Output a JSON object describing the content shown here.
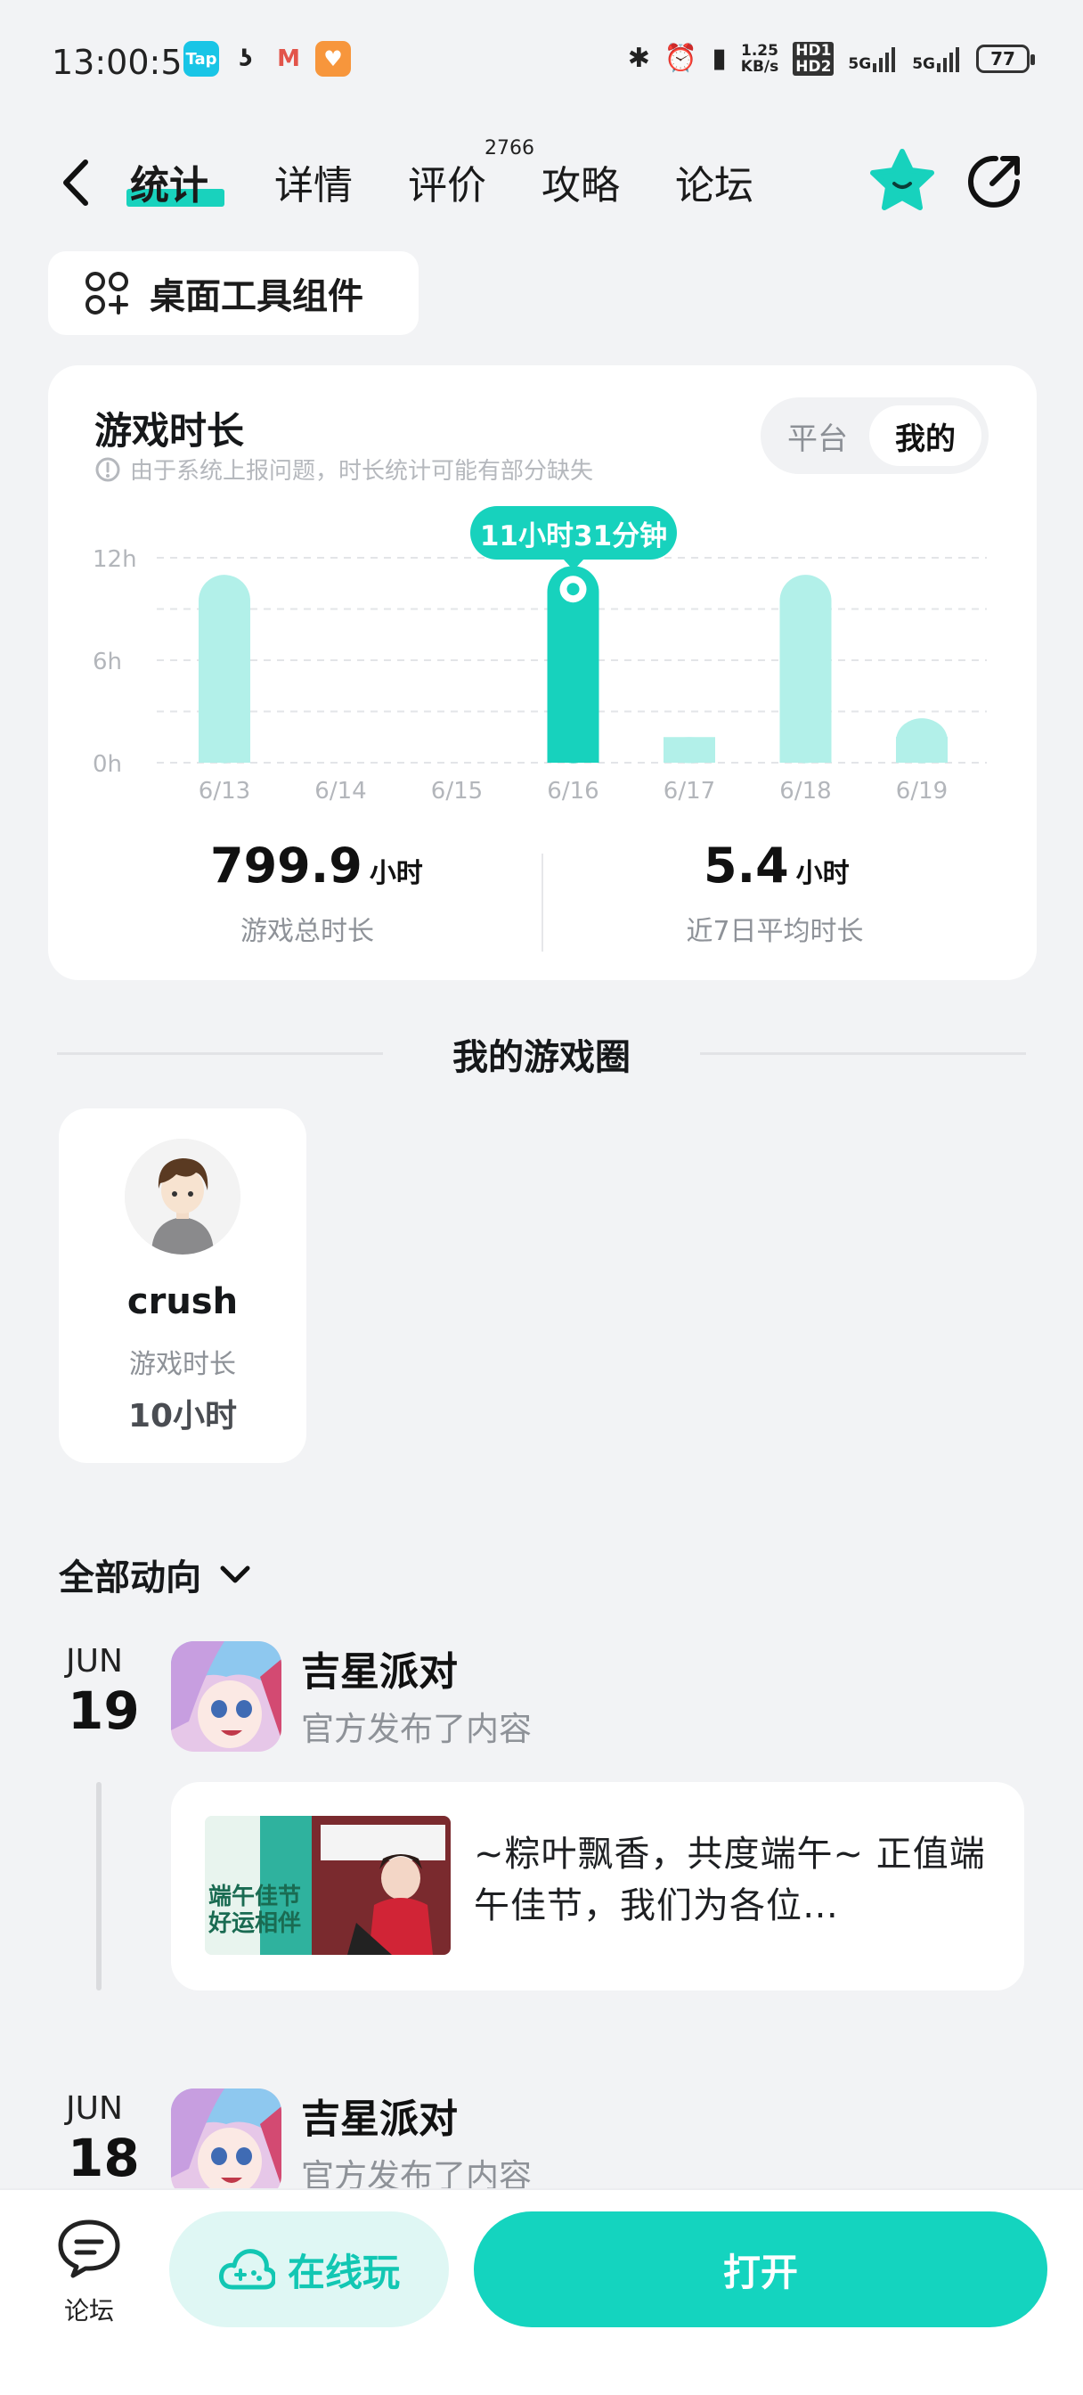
{
  "status_bar": {
    "time": "13:00:57",
    "apps": [
      "Tap",
      "ʖ",
      "M",
      "♥"
    ],
    "net_speed_top": "1.25",
    "net_speed_bottom": "KB/s",
    "hd1": "HD1",
    "hd2": "HD2",
    "sig1": "5G",
    "sig2": "5G",
    "battery": "77"
  },
  "nav": {
    "tabs": [
      {
        "label": "统计",
        "active": true
      },
      {
        "label": "详情"
      },
      {
        "label": "评价"
      },
      {
        "label": "攻略"
      },
      {
        "label": "论坛"
      }
    ],
    "review_count": "2766"
  },
  "widget_button": {
    "label": "桌面工具组件"
  },
  "game_time": {
    "title": "游戏时长",
    "note": "由于系统上报问题，时长统计可能有部分缺失",
    "toggle": {
      "platform": "平台",
      "mine": "我的",
      "selected": "我的"
    },
    "tooltip": "11小时31分钟",
    "total_value": "799.9",
    "total_unit": "小时",
    "total_label": "游戏总时长",
    "avg_value": "5.4",
    "avg_unit": "小时",
    "avg_label": "近7日平均时长"
  },
  "chart_data": {
    "type": "bar",
    "categories": [
      "6/13",
      "6/14",
      "6/15",
      "6/16",
      "6/17",
      "6/18",
      "6/19"
    ],
    "values": [
      11.0,
      0,
      0,
      11.52,
      1.5,
      11.0,
      2.6
    ],
    "y_ticks": [
      "12h",
      "6h",
      "0h"
    ],
    "ylim": [
      0,
      12
    ],
    "highlighted_index": 3,
    "colors": {
      "bar": "#b2f0e9",
      "highlight": "#17d2bd"
    },
    "grid": true
  },
  "game_circle": {
    "title": "我的游戏圈",
    "friends": [
      {
        "name": "crush",
        "label": "游戏时长",
        "value": "10小时"
      }
    ]
  },
  "feed": {
    "filter_label": "全部动向",
    "items": [
      {
        "month": "JUN",
        "day": "19",
        "game": "吉星派对",
        "action": "官方发布了内容",
        "post_text": "~粽叶飘香，共度端午~ 正值端午佳节，我们为各位…",
        "thumb_text": "端午佳节 好运相伴"
      },
      {
        "month": "JUN",
        "day": "18",
        "game": "吉星派对",
        "action": "官方发布了内容"
      }
    ]
  },
  "bottom_bar": {
    "forum": "论坛",
    "online_play": "在线玩",
    "open": "打开"
  },
  "colors": {
    "accent": "#17d2bd",
    "background": "#f2f3f5"
  }
}
